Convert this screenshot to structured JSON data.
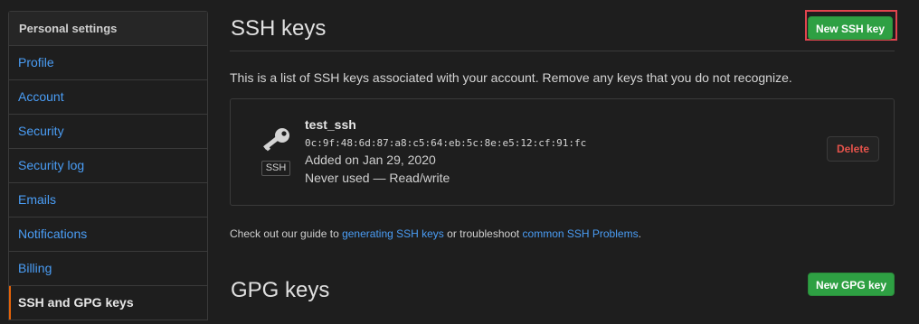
{
  "sidebar": {
    "header": "Personal settings",
    "items": [
      {
        "label": "Profile"
      },
      {
        "label": "Account"
      },
      {
        "label": "Security"
      },
      {
        "label": "Security log"
      },
      {
        "label": "Emails"
      },
      {
        "label": "Notifications"
      },
      {
        "label": "Billing"
      },
      {
        "label": "SSH and GPG keys",
        "active": true
      }
    ]
  },
  "ssh": {
    "title": "SSH keys",
    "new_button": "New SSH key",
    "description": "This is a list of SSH keys associated with your account. Remove any keys that you do not recognize.",
    "key": {
      "icon": "key-icon",
      "badge": "SSH",
      "name": "test_ssh",
      "fingerprint": "0c:9f:48:6d:87:a8:c5:64:eb:5c:8e:e5:12:cf:91:fc",
      "added": "Added on Jan 29, 2020",
      "usage": "Never used — Read/write",
      "delete_button": "Delete"
    },
    "guide": {
      "prefix": "Check out our guide to ",
      "link1": "generating SSH keys",
      "middle": " or troubleshoot ",
      "link2": "common SSH Problems",
      "suffix": "."
    }
  },
  "gpg": {
    "title": "GPG keys",
    "new_button": "New GPG key"
  },
  "colors": {
    "background": "#1e1e1e",
    "link": "#4a9df5",
    "green_button": "#2ea043",
    "active_indicator": "#e36209",
    "delete_text": "#e5534b",
    "highlight_box": "#e0444e"
  }
}
